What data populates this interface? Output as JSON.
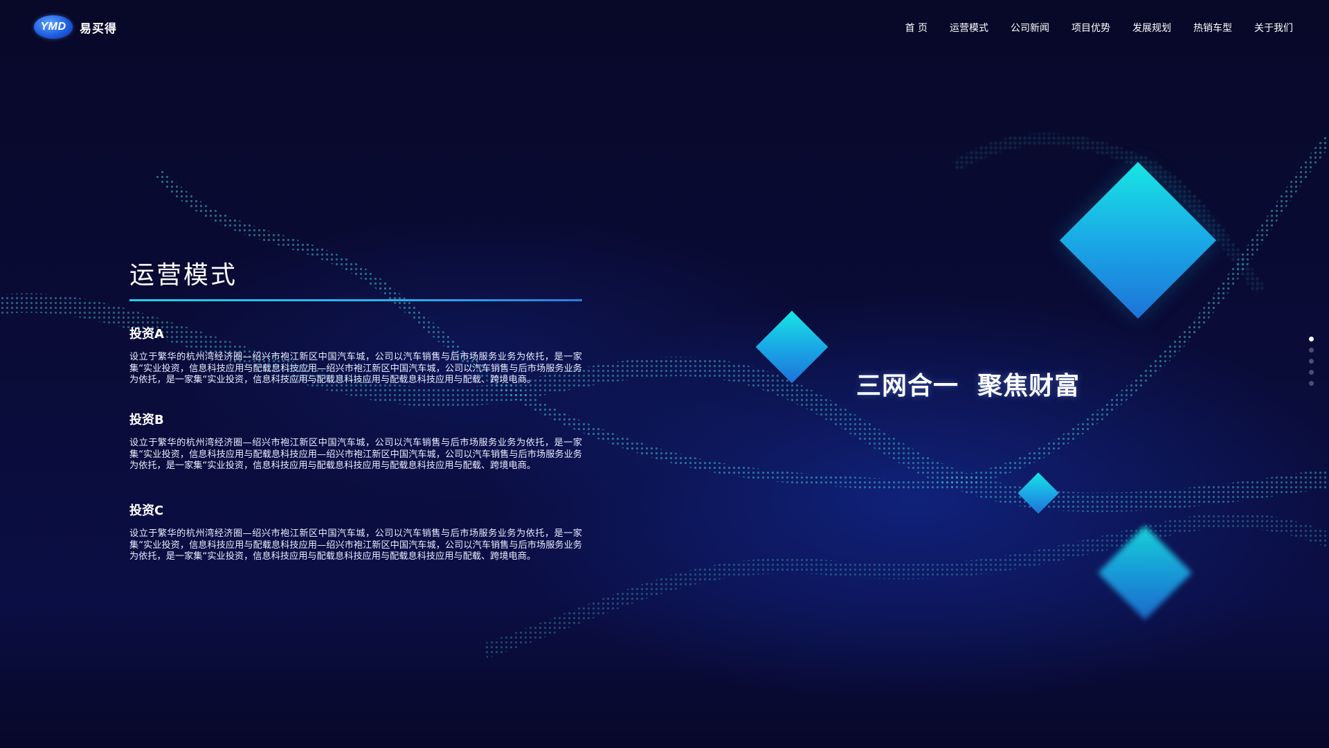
{
  "brand": {
    "logo_text": "YMD",
    "name": "易买得"
  },
  "nav": {
    "items": [
      {
        "label": "首 页"
      },
      {
        "label": "运营模式"
      },
      {
        "label": "公司新闻"
      },
      {
        "label": "项目优势"
      },
      {
        "label": "发展规划"
      },
      {
        "label": "热销车型"
      },
      {
        "label": "关于我们"
      }
    ]
  },
  "main": {
    "title": "运营模式",
    "blocks": [
      {
        "title": "投资A",
        "text": "设立于繁华的杭州湾经济圈—绍兴市袍江新区中国汽车城，公司以汽车销售与后市场服务业务为依托，是一家集“实业投资，信息科技应用与配载息科技应用—绍兴市袍江新区中国汽车城，公司以汽车销售与后市场服务业务为依托，是一家集“实业投资，信息科技应用与配载息科技应用与配载息科技应用与配载、跨境电商。"
      },
      {
        "title": "投资B",
        "text": "设立于繁华的杭州湾经济圈—绍兴市袍江新区中国汽车城，公司以汽车销售与后市场服务业务为依托，是一家集“实业投资，信息科技应用与配载息科技应用—绍兴市袍江新区中国汽车城，公司以汽车销售与后市场服务业务为依托，是一家集“实业投资，信息科技应用与配载息科技应用与配载息科技应用与配载、跨境电商。"
      },
      {
        "title": "投资C",
        "text": "设立于繁华的杭州湾经济圈—绍兴市袍江新区中国汽车城，公司以汽车销售与后市场服务业务为依托，是一家集“实业投资，信息科技应用与配载息科技应用—绍兴市袍江新区中国汽车城，公司以汽车销售与后市场服务业务为依托，是一家集“实业投资，信息科技应用与配载息科技应用与配载息科技应用与配载、跨境电商。"
      }
    ]
  },
  "hero": {
    "slogan": "三网合一  聚焦财富"
  },
  "pager": {
    "count": 5,
    "active_index": 0
  },
  "colors": {
    "background": "#070828",
    "accent_cyan": "#1fd3e6",
    "accent_blue": "#1d73d8"
  }
}
